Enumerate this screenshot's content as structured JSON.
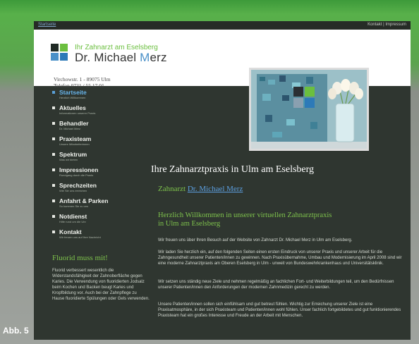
{
  "topbar": {
    "start_link": "Startseite",
    "links": "Kontakt | Impressum"
  },
  "header": {
    "brand_sub": "Ihr Zahnarzt am Eselsberg",
    "brand_main_prefix": "Dr. Michael ",
    "brand_main_m": "M",
    "brand_main_rest": "erz",
    "address_line1": "Virchowstr. 1 - 89075 Ulm",
    "address_line2": "Telefon 0731 / 55 17 01"
  },
  "nav": {
    "items": [
      {
        "label": "Startseite",
        "sub": "Herzlich Willkommen",
        "active": true
      },
      {
        "label": "Aktuelles",
        "sub": "Informationen unserer Praxis"
      },
      {
        "label": "Behandler",
        "sub": "Dr. Michael Merz"
      },
      {
        "label": "Praxisteam",
        "sub": "Unsere Mitarbeiterinnen"
      },
      {
        "label": "Spektrum",
        "sub": "Was wir bieten"
      },
      {
        "label": "Impressionen",
        "sub": "Rundgang durch die Praxis"
      },
      {
        "label": "Sprechzeiten",
        "sub": "Wie Sie uns erreichen"
      },
      {
        "label": "Anfahrt & Parken",
        "sub": "So kommen Sie zu uns"
      },
      {
        "label": "Notdienst",
        "sub": "Hilfe rund um die Uhr"
      },
      {
        "label": "Kontakt",
        "sub": "Wir freuen uns auf Ihre Nachricht"
      }
    ]
  },
  "fluorid": {
    "title": "Fluorid muss mit!",
    "text": "Fluorid verbessert wesentlich die Widerstandsfähigkeit der Zahnoberfläche gegen Karies. Die Verwendung von fluoridierten Jodsalz beim Kochen und Backen beugt Karies und Kropfbildung vor. Auch bei der Zahnpflege zu Hause fluoridierte Spülungen oder Gels verwenden."
  },
  "content": {
    "title": "Ihre Zahnarztpraxis in Ulm am Eselsberg",
    "doctor_prefix": "Zahnarzt ",
    "doctor_link": "Dr. Michael Merz",
    "welcome_line1": "Herzlich Willkommen in unserer virtuellen Zahnarztpraxis",
    "welcome_line2": "in Ulm am Eselsberg",
    "p1": "Wir freuen uns über Ihren Besuch auf der Website von Zahnarzt Dr. Michael Merz in Ulm am Eselsberg.",
    "p2": "Wir laden Sie herzlich ein, auf den folgenden Seiten einen ersten Eindruck von unserer Praxis und unserer Arbeit für die Zahngesundheit unserer Patienten/innen zu gewinnen. Nach Praxisübernahme, Umbau und Modernisierung im April 2008 sind wir eine moderne Zahnarztpraxis am Oberen Eselsberg in Ulm - unweit von Bundeswehrkrankenhaus und Universitätsklinik.",
    "p3": "Wir setzen uns ständig neue Ziele und nehmen regelmäßig an fachlichen Fort- und Weiterbildungen teil, um den Bedürfnissen unserer Patienten/innen den Anforderungen der modernen Zahnmedizin gerecht zu werden.",
    "p4": "Unsere Patienten/innen sollen sich einfühlsam und gut betreut fühlen. Wichtig zur Erreichung unserer Ziele ist eine Praxisatmosphäre, in der sich Praxisteam und Patienten/innen wohl fühlen. Unser fachlich fortgebildetes und gut funktionierendes Praxisteam hat ein großes Interesse und Freude an der Arbeit mit Menschen."
  },
  "figure_label": "Abb. 5",
  "colors": {
    "accent_green": "#7ec24c",
    "accent_blue": "#5c9fe0",
    "site_bg": "#2f3630"
  }
}
